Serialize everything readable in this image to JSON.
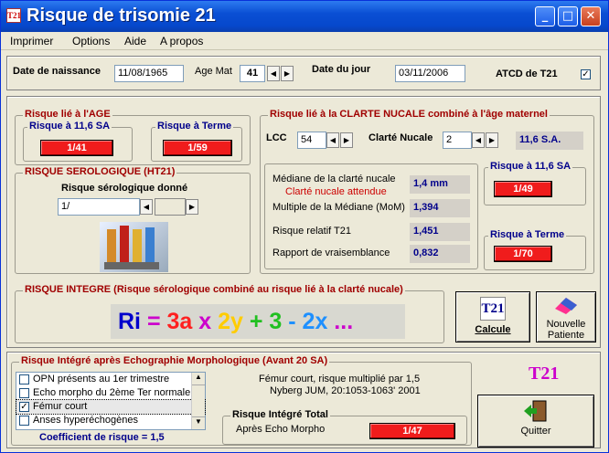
{
  "window": {
    "title": "Risque de trisomie 21",
    "icon_text": "T21",
    "controls": {
      "minimize": "_",
      "maximize": "□",
      "close": "✕"
    }
  },
  "menu": [
    "Imprimer",
    "Options",
    "Aide",
    "A propos"
  ],
  "header": {
    "date_naissance_label": "Date de naissance",
    "date_naissance": "11/08/1965",
    "age_mat_label": "Age Mat",
    "age_mat": "41",
    "date_jour_label": "Date du jour",
    "date_jour": "03/11/2006",
    "atcd_label": "ATCD de T21",
    "atcd_checked": true
  },
  "risque_age": {
    "title": "Risque lié à l'AGE",
    "sa_label": "Risque à 11,6 SA",
    "sa_value": "1/41",
    "terme_label": "Risque à Terme",
    "terme_value": "1/59"
  },
  "serologique": {
    "title": "RISQUE SEROLOGIQUE (HT21)",
    "given_label": "Risque sérologique donné",
    "input_value": "1/"
  },
  "clarte": {
    "title": "Risque lié à la CLARTE NUCALE combiné à l'âge maternel",
    "lcc_label": "LCC",
    "lcc_value": "54",
    "clarte_label": "Clarté Nucale",
    "clarte_value": "2",
    "sa_readout": "11,6 S.A.",
    "rows": [
      {
        "label": "Médiane de la clarté nucale",
        "value": "1,4 mm",
        "sublabel": "Clarté nucale attendue"
      },
      {
        "label": "Multiple de la Médiane (MoM)",
        "value": "1,394"
      },
      {
        "label": "Risque relatif T21",
        "value": "1,451"
      },
      {
        "label": "Rapport de vraisemblance",
        "value": "0,832"
      }
    ],
    "sa_risk_label": "Risque à 11,6 SA",
    "sa_risk_value": "1/49",
    "terme_risk_label": "Risque à Terme",
    "terme_risk_value": "1/70"
  },
  "integre": {
    "title": "RISQUE INTEGRE (Risque sérologique combiné au risque lié à la clarté nucale)",
    "formula": [
      {
        "text": "Ri",
        "color": "#0000cc"
      },
      {
        "text": " = ",
        "color": "#cc00cc"
      },
      {
        "text": "3a",
        "color": "#ff2020"
      },
      {
        "text": " x ",
        "color": "#cc00cc"
      },
      {
        "text": "2y",
        "color": "#ffcc00"
      },
      {
        "text": " + ",
        "color": "#20c020"
      },
      {
        "text": "3",
        "color": "#20c020"
      },
      {
        "text": " - ",
        "color": "#1e90ff"
      },
      {
        "text": "2x",
        "color": "#1e90ff"
      },
      {
        "text": " ...",
        "color": "#cc00cc"
      }
    ]
  },
  "calcule_button": {
    "icon_text": "T21",
    "label": "Calcule"
  },
  "nouvelle_button": {
    "label_line1": "Nouvelle",
    "label_line2": "Patiente"
  },
  "echo": {
    "title": "Risque Intégré après Echographie Morphologique (Avant 20 SA)",
    "items": [
      {
        "label": "OPN présents au 1er trimestre",
        "checked": false
      },
      {
        "label": "Echo morpho du 2ème Ter normale",
        "checked": false
      },
      {
        "label": "Fémur court",
        "checked": true
      },
      {
        "label": "Anses hyperéchogènes",
        "checked": false
      }
    ],
    "coef_label": "Coefficient de risque = 1,5",
    "note_line1": "Fémur court, risque multiplié par 1,5",
    "note_line2": "Nyberg JUM, 20:1053-1063' 2001",
    "total_title": "Risque Intégré Total",
    "total_label": "Après Echo Morpho",
    "total_value": "1/47"
  },
  "logo_text": "T21",
  "quitter_label": "Quitter",
  "colors": {
    "titlebar": "#0a4fd4",
    "risk_red": "#f01c1c",
    "legend_red": "#a00000",
    "readout_blue": "#00008b",
    "coef_blue": "#00008b"
  }
}
